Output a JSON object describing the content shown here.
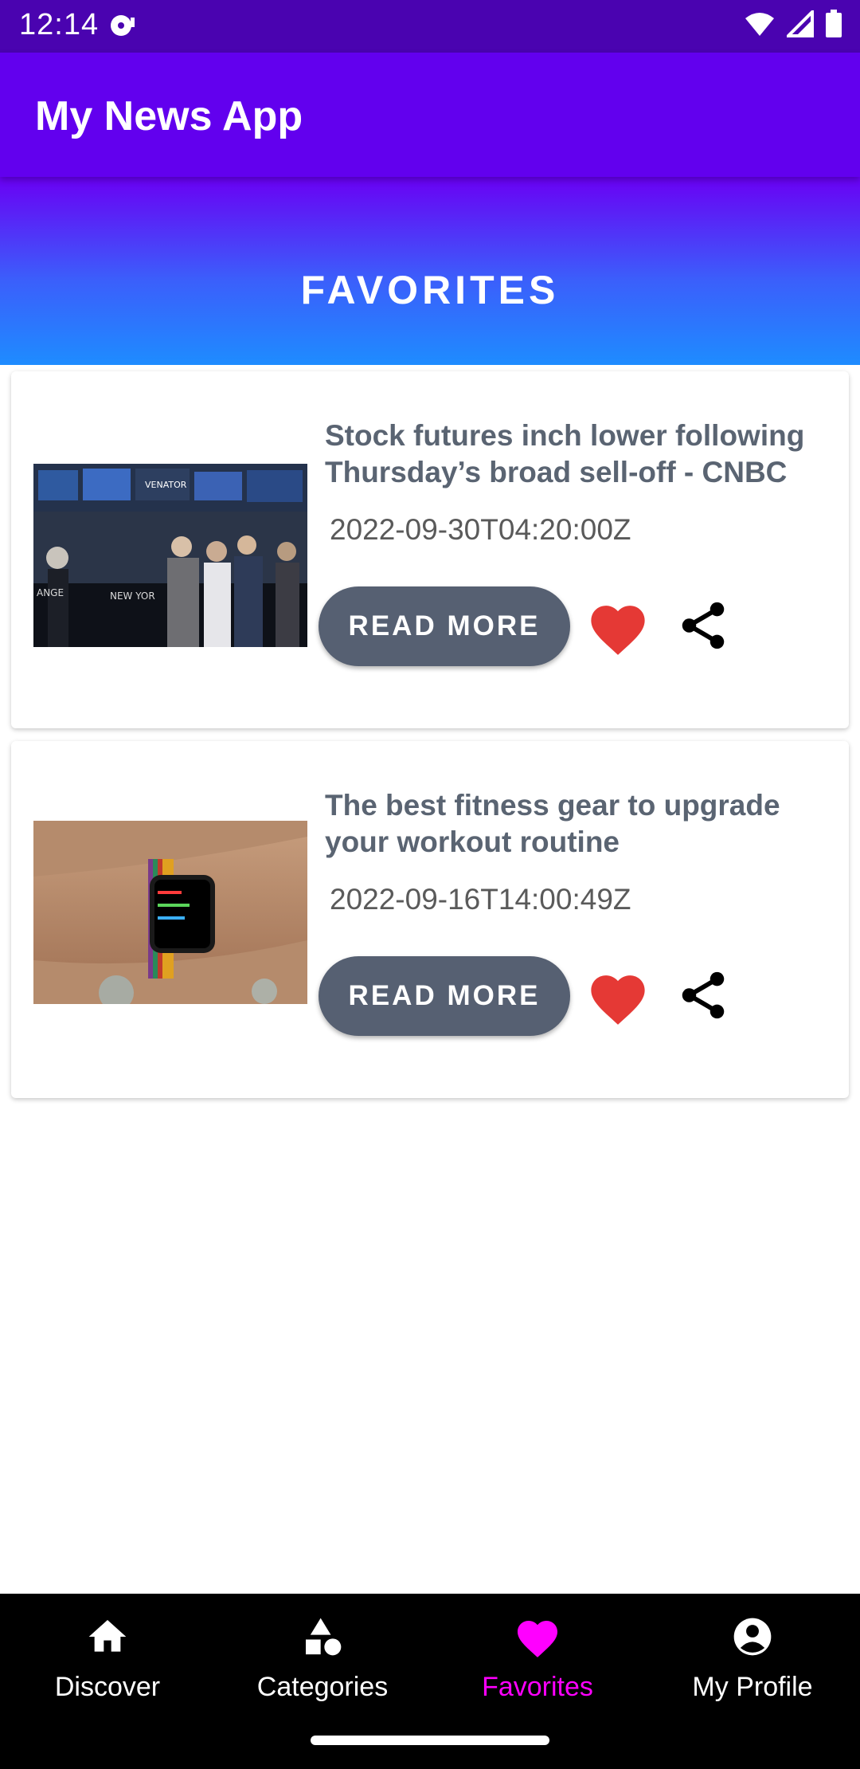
{
  "status_bar": {
    "time": "12:14"
  },
  "app_bar": {
    "title": "My News App"
  },
  "section": {
    "title": "FAVORITES"
  },
  "articles": [
    {
      "title": "Stock futures inch lower following Thursday’s broad sell-off - CNBC",
      "date": "2022-09-30T04:20:00Z",
      "button": "READ MORE",
      "thumb_caption_left": "ANGE",
      "thumb_caption_mid": "NEW YOR",
      "thumb_sign": "VENATOR"
    },
    {
      "title": "The best fitness gear to upgrade your workout routine",
      "date": "2022-09-16T14:00:49Z",
      "button": "READ MORE"
    }
  ],
  "bottom_nav": [
    {
      "label": "Discover",
      "icon": "home-icon"
    },
    {
      "label": "Categories",
      "icon": "shapes-icon"
    },
    {
      "label": "Favorites",
      "icon": "heart-icon",
      "active": true
    },
    {
      "label": "My Profile",
      "icon": "account-circle-icon"
    }
  ],
  "colors": {
    "app_bar": "#6200ee",
    "status_bar": "#4a03b0",
    "button": "#566072",
    "heart": "#e53935",
    "active_nav": "#ff00ff"
  }
}
